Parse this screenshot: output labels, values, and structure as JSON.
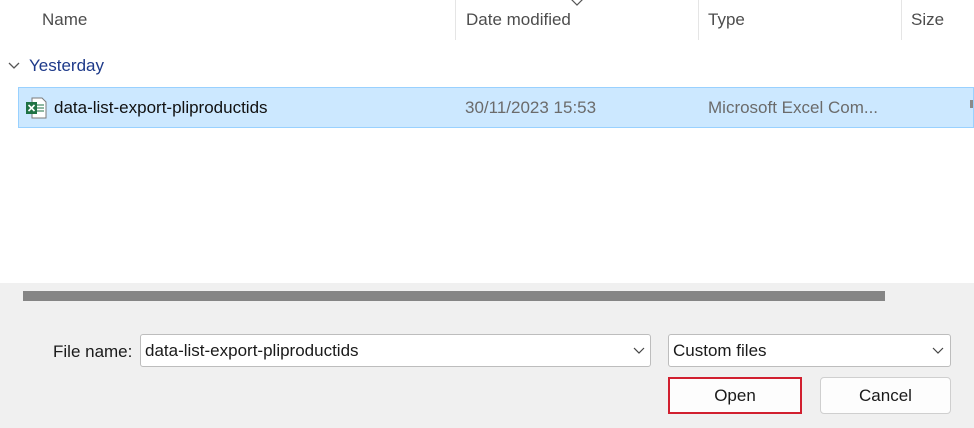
{
  "columns": {
    "name": "Name",
    "date_modified": "Date modified",
    "type": "Type",
    "size": "Size"
  },
  "group": {
    "label": "Yesterday"
  },
  "files": [
    {
      "name": "data-list-export-pliproductids",
      "date_modified": "30/11/2023 15:53",
      "type": "Microsoft Excel Com...",
      "icon": "excel-file-icon",
      "selected": true
    }
  ],
  "footer": {
    "file_name_label": "File name:",
    "file_name_value": "data-list-export-pliproductids",
    "file_type_filter": "Custom files",
    "open_label": "Open",
    "cancel_label": "Cancel"
  },
  "colors": {
    "selection_bg": "#cce8ff",
    "selection_border": "#99d1ff",
    "group_label": "#1e3a8a",
    "open_highlight": "#d11f2f",
    "excel_green": "#1f7244"
  }
}
